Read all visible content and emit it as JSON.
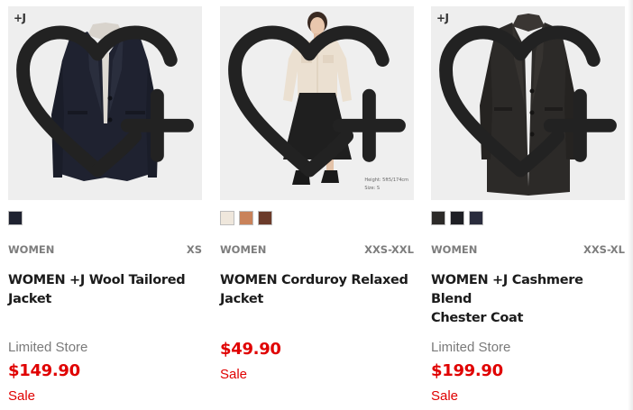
{
  "products": [
    {
      "name_line1": "WOMEN +J Wool Tailored",
      "name_line2": "Jacket",
      "gender": "WOMEN",
      "size_range": "XS",
      "badge": "+J",
      "store_label": "Limited Store",
      "price": "$149.90",
      "sale_label": "Sale",
      "swatches": [
        "#1f2230"
      ],
      "favorite_icon": "heart-plus-icon"
    },
    {
      "name_line1": "WOMEN Corduroy Relaxed",
      "name_line2": "Jacket",
      "gender": "WOMEN",
      "size_range": "XXS-XXL",
      "badge": "",
      "store_label": "",
      "price": "$49.90",
      "sale_label": "Sale",
      "swatches": [
        "#efe7dc",
        "#c9825a",
        "#6b3b2a"
      ],
      "favorite_icon": "heart-plus-icon",
      "photo_caption_1": "Height: 5ft5/174cm",
      "photo_caption_2": "Size: S"
    },
    {
      "name_line1": "WOMEN +J Cashmere Blend",
      "name_line2": "Chester Coat",
      "gender": "WOMEN",
      "size_range": "XXS-XL",
      "badge": "+J",
      "store_label": "Limited Store",
      "price": "$199.90",
      "sale_label": "Sale",
      "swatches": [
        "#2c2a28",
        "#1e1f24",
        "#2a2c3d"
      ],
      "favorite_icon": "heart-plus-icon"
    }
  ],
  "colors": {
    "price_red": "#e00000",
    "muted_gray": "#7d7d7d",
    "image_bg": "#eeeeee"
  }
}
